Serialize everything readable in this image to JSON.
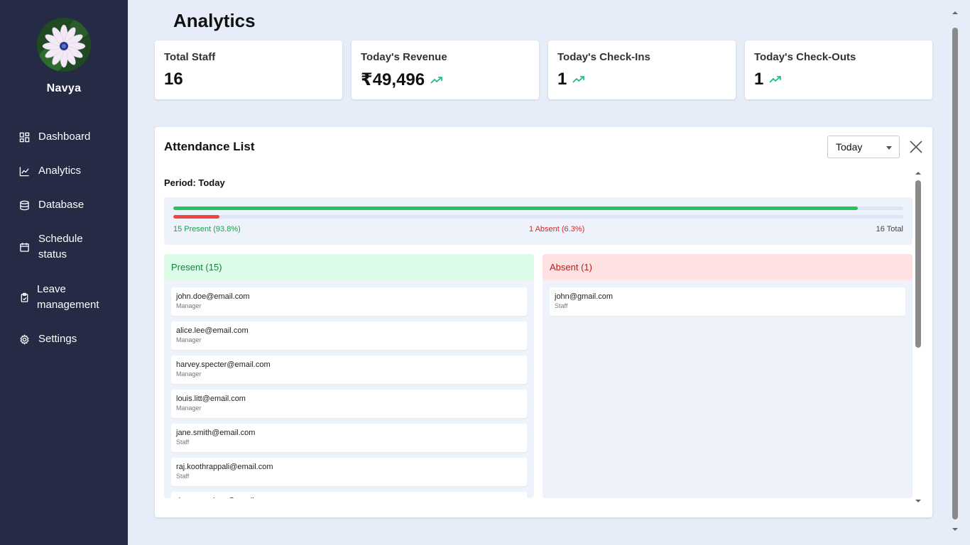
{
  "sidebar": {
    "user_name": "Navya",
    "nav": [
      {
        "label": "Dashboard",
        "icon": "dashboard-grid-icon"
      },
      {
        "label": "Analytics",
        "icon": "line-chart-icon"
      },
      {
        "label": "Database",
        "icon": "database-icon"
      },
      {
        "label": "Schedule status",
        "icon": "calendar-icon"
      },
      {
        "label": "Leave management",
        "icon": "clipboard-icon"
      },
      {
        "label": "Settings",
        "icon": "gear-icon"
      }
    ]
  },
  "header": {
    "title": "Analytics"
  },
  "stats": [
    {
      "label": "Total Staff",
      "value": "16"
    },
    {
      "label": "Today's Revenue",
      "value": "₹49,496"
    },
    {
      "label": "Today's Check-Ins",
      "value": "1"
    },
    {
      "label": "Today's Check-Outs",
      "value": "1"
    }
  ],
  "attendance": {
    "title": "Attendance List",
    "period_select": "Today",
    "period_text": "Period: Today",
    "present_fraction": 0.938,
    "absent_fraction": 0.063,
    "present_summary": "15 Present (93.8%)",
    "absent_summary": "1 Absent (6.3%)",
    "total_summary": "16 Total",
    "present_header": "Present (15)",
    "absent_header": "Absent (1)",
    "present_list": [
      {
        "email": "john.doe@email.com",
        "role": "Manager"
      },
      {
        "email": "alice.lee@email.com",
        "role": "Manager"
      },
      {
        "email": "harvey.specter@email.com",
        "role": "Manager"
      },
      {
        "email": "louis.litt@email.com",
        "role": "Manager"
      },
      {
        "email": "jane.smith@email.com",
        "role": "Staff"
      },
      {
        "email": "raj.koothrappali@email.com",
        "role": "Staff"
      },
      {
        "email": "donna.paulsen@email.com",
        "role": ""
      }
    ],
    "absent_list": [
      {
        "email": "john@gmail.com",
        "role": "Staff"
      }
    ]
  },
  "colors": {
    "sidebar_bg": "#252a45",
    "page_bg": "#e6edf8",
    "present": "#22c55e",
    "absent": "#ef4444",
    "trend": "#10b981"
  }
}
